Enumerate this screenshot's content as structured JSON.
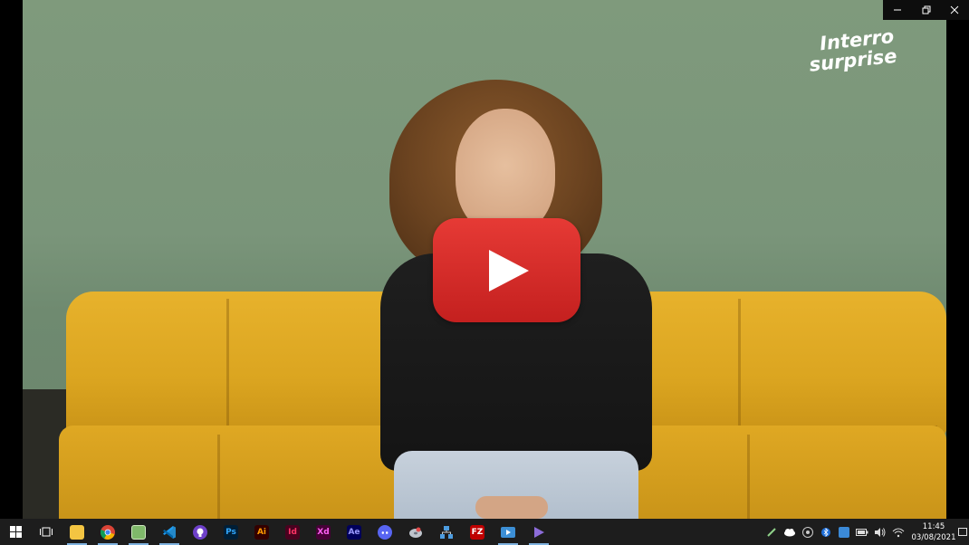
{
  "video": {
    "brand_line1": "Interro",
    "brand_line2": "surprise",
    "play_color": "#d52b27"
  },
  "window_controls": {
    "minimize_icon": "minimize-icon",
    "restore_icon": "restore-icon",
    "close_icon": "close-icon"
  },
  "taskbar": {
    "apps": [
      {
        "name": "start",
        "icon": "windows-logo-icon"
      },
      {
        "name": "task-view",
        "icon": "task-view-icon"
      },
      {
        "name": "file-explorer",
        "icon": "folder-icon",
        "active": true
      },
      {
        "name": "chrome",
        "icon": "chrome-icon",
        "active": true
      },
      {
        "name": "notepad",
        "icon": "notepad-icon",
        "active": true
      },
      {
        "name": "vscode",
        "icon": "vscode-icon",
        "active": true
      },
      {
        "name": "github-desktop",
        "icon": "github-icon"
      },
      {
        "name": "photoshop",
        "label": "Ps",
        "color": "#31a8ff",
        "bg": "#001e36"
      },
      {
        "name": "illustrator",
        "label": "Ai",
        "color": "#ff9a00",
        "bg": "#330000"
      },
      {
        "name": "indesign",
        "label": "Id",
        "color": "#ff3366",
        "bg": "#49021f"
      },
      {
        "name": "xd",
        "label": "Xd",
        "color": "#ff61f6",
        "bg": "#470137"
      },
      {
        "name": "after-effects",
        "label": "Ae",
        "color": "#9999ff",
        "bg": "#00005b"
      },
      {
        "name": "discord",
        "icon": "discord-icon"
      },
      {
        "name": "app-disk",
        "icon": "disk-icon"
      },
      {
        "name": "network-app",
        "icon": "network-icon"
      },
      {
        "name": "filezilla",
        "label": "FZ",
        "color": "#ffffff",
        "bg": "#bf0000"
      },
      {
        "name": "media-player",
        "icon": "media-player-icon",
        "active": true
      },
      {
        "name": "visual-studio",
        "icon": "visual-studio-icon",
        "active": true
      }
    ],
    "tray": {
      "icons": [
        "pen-icon",
        "cloud-icon",
        "steam-icon",
        "bluetooth-icon",
        "app-tray-icon",
        "battery-icon",
        "volume-icon",
        "wifi-icon"
      ],
      "time": "11:45",
      "date": "03/08/2021"
    }
  }
}
